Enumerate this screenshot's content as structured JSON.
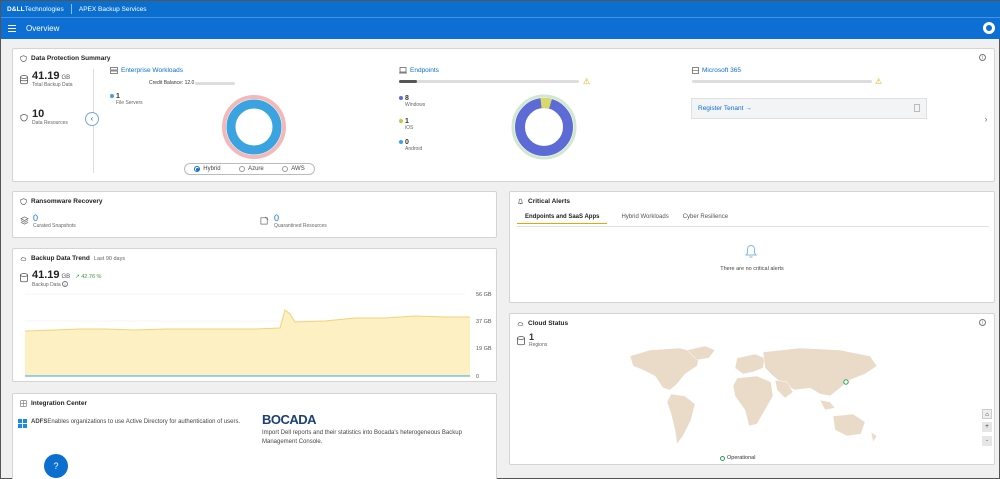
{
  "header": {
    "brand_bold": "D&LL",
    "brand_light": "Technologies",
    "app_title": "APEX Backup Services"
  },
  "nav": {
    "page_title": "Overview"
  },
  "dps": {
    "title": "Data Protection Summary",
    "total_backup_value": "41.19",
    "total_backup_unit": "GB",
    "total_backup_label": "Total Backup Data",
    "resources_value": "10",
    "resources_label": "Data Resources",
    "enterprise": {
      "title": "Enterprise Workloads",
      "credit_label": "Credit Balance:",
      "credit_value": "12.0",
      "file_servers_value": "1",
      "file_servers_label": "File Servers",
      "options": [
        "Hybrid",
        "Azure",
        "AWS"
      ],
      "selected": "Hybrid"
    },
    "endpoints": {
      "title": "Endpoints",
      "items": [
        {
          "value": "8",
          "label": "Windows",
          "color": "#5e6bd6"
        },
        {
          "value": "1",
          "label": "iOS",
          "color": "#c8c83a"
        },
        {
          "value": "0",
          "label": "Android",
          "color": "#3aa3e0"
        }
      ]
    },
    "m365": {
      "title": "Microsoft 365",
      "register_label": "Register Tenant →"
    }
  },
  "ransomware": {
    "title": "Ransomware Recovery",
    "curated_value": "0",
    "curated_label": "Curated Snapshots",
    "quarantined_value": "0",
    "quarantined_label": "Quarantined Resources"
  },
  "trend": {
    "title": "Backup Data Trend",
    "period": "Last 90 days",
    "value": "41.19",
    "unit": "GB",
    "change": "↗ 42.76 %",
    "label": "Backup Data",
    "ticks": [
      "56 GB",
      "37 GB",
      "19 GB",
      "0"
    ]
  },
  "alerts": {
    "title": "Critical Alerts",
    "tabs": [
      "Endpoints and SaaS Apps",
      "Hybrid Workloads",
      "Cyber Resilience"
    ],
    "empty_text": "There are no critical alerts"
  },
  "cloud": {
    "title": "Cloud Status",
    "regions_value": "1",
    "regions_label": "Regions",
    "legend": "Operational",
    "zoom_in": "+",
    "zoom_out": "-"
  },
  "integration": {
    "title": "Integration Center",
    "adfs_name": "ADFS",
    "adfs_desc": "Enables organizations to use Active Directory for authentication of users.",
    "bocada_name": "BOCADA",
    "bocada_desc": "Import Dell reports and their statistics into Bocada's heterogeneous Backup Management Console."
  },
  "colors": {
    "brand_blue": "#0b6fd0",
    "accent_orange": "#f4a100",
    "trend_fill": "#fdf0c2",
    "trend_line": "#f3d27a"
  }
}
